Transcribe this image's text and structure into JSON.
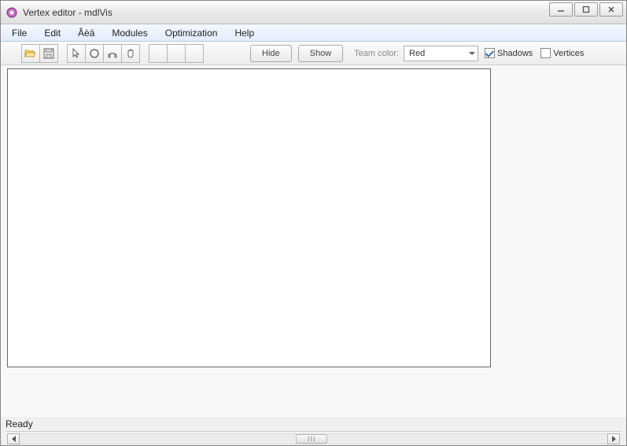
{
  "window": {
    "title": "Vertex editor - mdlVis"
  },
  "menu": {
    "items": [
      "File",
      "Edit",
      "Âèä",
      "Modules",
      "Optimization",
      "Help"
    ]
  },
  "toolbar": {
    "hide_label": "Hide",
    "show_label": "Show",
    "team_color_label": "Team color:",
    "team_color_value": "Red",
    "shadows_label": "Shadows",
    "shadows_checked": true,
    "vertices_label": "Vertices",
    "vertices_checked": false
  },
  "status": {
    "text": "Ready"
  },
  "scrollbar": {
    "thumb_label": "III"
  }
}
